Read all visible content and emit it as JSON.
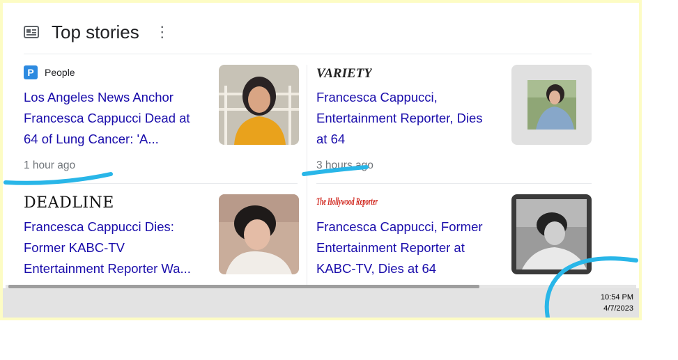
{
  "header": {
    "title": "Top stories",
    "icon": "newspaper-icon",
    "menu_icon": "more-vert-icon"
  },
  "stories": [
    {
      "source": "People",
      "logo_text": "P",
      "headline": "Los Angeles News Anchor\nFrancesca Cappucci Dead at\n64 of Lung Cancer: 'A...",
      "time": "1 hour ago"
    },
    {
      "source": "VARIETY",
      "headline": "Francesca Cappucci,\nEntertainment Reporter, Dies\nat 64",
      "time": "3 hours ago"
    },
    {
      "source": "DEADLINE",
      "headline": "Francesca Cappucci Dies:\nFormer KABC-TV\nEntertainment Reporter Wa..."
    },
    {
      "source": "The Hollywood Reporter",
      "headline": "Francesca Cappucci, Former\nEntertainment Reporter at\nKABC-TV, Dies at 64"
    }
  ],
  "taskbar": {
    "time": "10:54 PM",
    "date": "4/7/2023"
  },
  "colors": {
    "headline": "#1a0dab",
    "annotation": "#29b6e8",
    "frame": "#fdfcc4"
  }
}
